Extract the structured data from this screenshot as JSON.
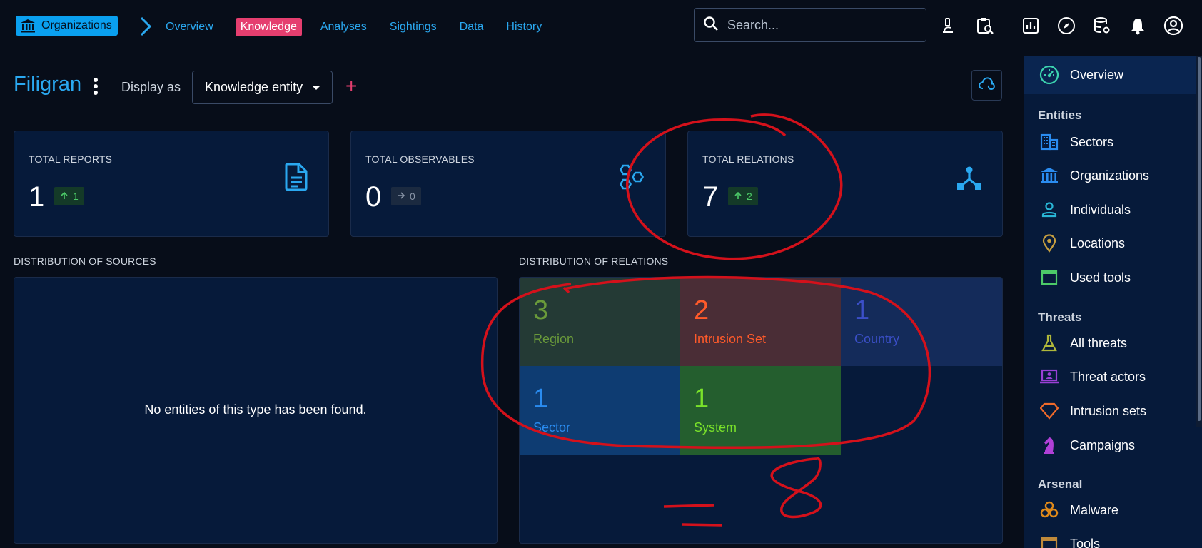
{
  "nav": {
    "org_chip": "Organizations",
    "links": [
      "Overview",
      "Knowledge",
      "Analyses",
      "Sightings",
      "Data",
      "History"
    ],
    "active_link": "Knowledge",
    "search_placeholder": "Search..."
  },
  "header": {
    "title": "Filigran",
    "display_as_label": "Display as",
    "display_mode": "Knowledge entity",
    "add_symbol": "+"
  },
  "stats": [
    {
      "label": "TOTAL REPORTS",
      "value": "1",
      "delta": "1",
      "trend": "up",
      "icon": "file-document-icon"
    },
    {
      "label": "TOTAL OBSERVABLES",
      "value": "0",
      "delta": "0",
      "trend": "flat",
      "icon": "hexagons-icon"
    },
    {
      "label": "TOTAL RELATIONS",
      "value": "7",
      "delta": "2",
      "trend": "up",
      "icon": "graph-nodes-icon"
    }
  ],
  "sources": {
    "title": "DISTRIBUTION OF SOURCES",
    "empty_text": "No entities of this type has been found."
  },
  "relations": {
    "title": "DISTRIBUTION OF RELATIONS",
    "tiles": [
      {
        "value": "3",
        "label": "Region",
        "color": "#6a9a3a",
        "bg": "#243a35"
      },
      {
        "value": "2",
        "label": "Intrusion Set",
        "color": "#ff5a2a",
        "bg": "#4a2d36"
      },
      {
        "value": "1",
        "label": "Country",
        "color": "#3b4fc8",
        "bg": "#142b5a"
      },
      {
        "value": "1",
        "label": "Sector",
        "color": "#2a8cf0",
        "bg": "#0e3c72"
      },
      {
        "value": "1",
        "label": "System",
        "color": "#7ae22a",
        "bg": "#245e2e"
      }
    ]
  },
  "sidebar": {
    "overview": "Overview",
    "groups": [
      {
        "title": "Entities",
        "items": [
          {
            "label": "Sectors",
            "icon": "domain-icon"
          },
          {
            "label": "Organizations",
            "icon": "bank-icon"
          },
          {
            "label": "Individuals",
            "icon": "person-icon"
          },
          {
            "label": "Locations",
            "icon": "map-marker-icon"
          },
          {
            "label": "Used tools",
            "icon": "window-icon"
          }
        ]
      },
      {
        "title": "Threats",
        "items": [
          {
            "label": "All threats",
            "icon": "flask-icon"
          },
          {
            "label": "Threat actors",
            "icon": "laptop-account-icon"
          },
          {
            "label": "Intrusion sets",
            "icon": "diamond-icon"
          },
          {
            "label": "Campaigns",
            "icon": "chess-knight-icon"
          }
        ]
      },
      {
        "title": "Arsenal",
        "items": [
          {
            "label": "Malware",
            "icon": "biohazard-icon"
          },
          {
            "label": "Tools",
            "icon": "tools-icon"
          }
        ]
      }
    ]
  },
  "annotations": {
    "handwritten_text": "= 8",
    "ink_color": "#d4111b"
  },
  "colors": {
    "accent": "#2aa8f0",
    "knowledge_tab": "#e53e6f",
    "card_bg": "#061a3a",
    "page_bg": "#070d19"
  }
}
